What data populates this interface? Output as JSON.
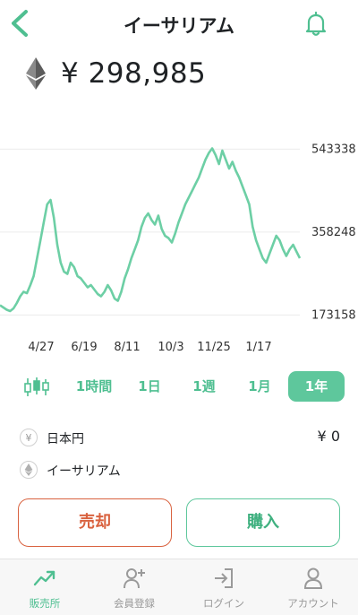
{
  "header": {
    "title": "イーサリアム"
  },
  "price": {
    "value": "¥ 298,985"
  },
  "chart_data": {
    "type": "line",
    "title": "",
    "xlabel": "",
    "ylabel": "",
    "x_tick_labels": [
      "4/27",
      "6/19",
      "8/11",
      "10/3",
      "11/25",
      "1/17"
    ],
    "y_tick_labels": [
      "543338",
      "358248",
      "173158"
    ],
    "ylim": [
      160000,
      600000
    ],
    "grid": true,
    "color": "#6dcfa5",
    "series": [
      {
        "values": [
          195000,
          190000,
          185000,
          182000,
          188000,
          200000,
          215000,
          225000,
          222000,
          240000,
          260000,
          300000,
          340000,
          380000,
          420000,
          430000,
          390000,
          330000,
          290000,
          270000,
          265000,
          290000,
          280000,
          260000,
          255000,
          245000,
          235000,
          240000,
          230000,
          220000,
          215000,
          225000,
          240000,
          228000,
          210000,
          205000,
          225000,
          255000,
          275000,
          300000,
          320000,
          340000,
          370000,
          390000,
          400000,
          385000,
          375000,
          395000,
          365000,
          350000,
          345000,
          335000,
          355000,
          380000,
          400000,
          420000,
          435000,
          450000,
          465000,
          480000,
          500000,
          520000,
          535000,
          545000,
          530000,
          510000,
          540000,
          520000,
          500000,
          515000,
          495000,
          480000,
          460000,
          440000,
          420000,
          370000,
          340000,
          320000,
          300000,
          290000,
          310000,
          330000,
          350000,
          340000,
          320000,
          305000,
          320000,
          330000,
          315000,
          300000
        ]
      }
    ]
  },
  "periods": [
    {
      "label": "1時間",
      "active": false
    },
    {
      "label": "1日",
      "active": false
    },
    {
      "label": "1週",
      "active": false
    },
    {
      "label": "1月",
      "active": false
    },
    {
      "label": "1年",
      "active": true
    }
  ],
  "assets": [
    {
      "icon": "yen-icon",
      "symbol": "¥",
      "name": "日本円",
      "amount": "¥ 0"
    },
    {
      "icon": "eth-icon",
      "symbol": "",
      "name": "イーサリアム",
      "amount": ""
    }
  ],
  "actions": {
    "sell": "売却",
    "buy": "購入"
  },
  "tabs": [
    {
      "icon": "trend-icon",
      "label": "販売所",
      "active": true
    },
    {
      "icon": "user-plus-icon",
      "label": "会員登録",
      "active": false
    },
    {
      "icon": "login-icon",
      "label": "ログイン",
      "active": false
    },
    {
      "icon": "account-icon",
      "label": "アカウント",
      "active": false
    }
  ],
  "colors": {
    "accent": "#5ec79c",
    "sell": "#d9623f",
    "text": "#1f2225"
  }
}
